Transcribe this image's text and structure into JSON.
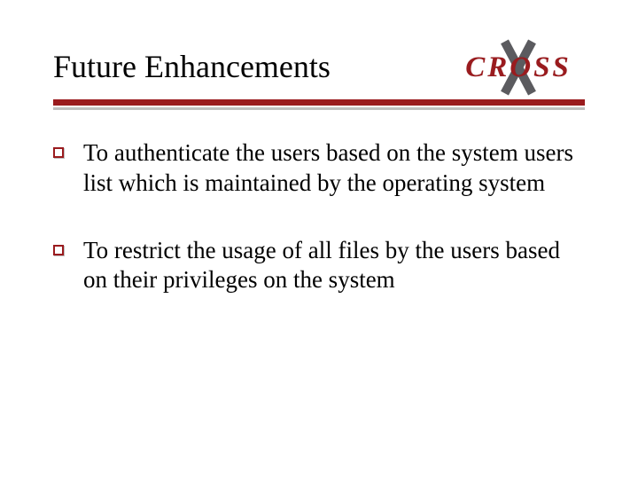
{
  "title": "Future Enhancements",
  "logo": {
    "text": "CROSS",
    "icon": "x-glyph"
  },
  "bullets": [
    "To authenticate the users based on the system users list which is maintained by the operating system",
    "To restrict the usage of all files by the users based on their privileges on the system"
  ],
  "colors": {
    "accent": "#9a1b1e",
    "rule_shadow": "#bfbfbf",
    "logo_x": "#5b5b5f"
  }
}
